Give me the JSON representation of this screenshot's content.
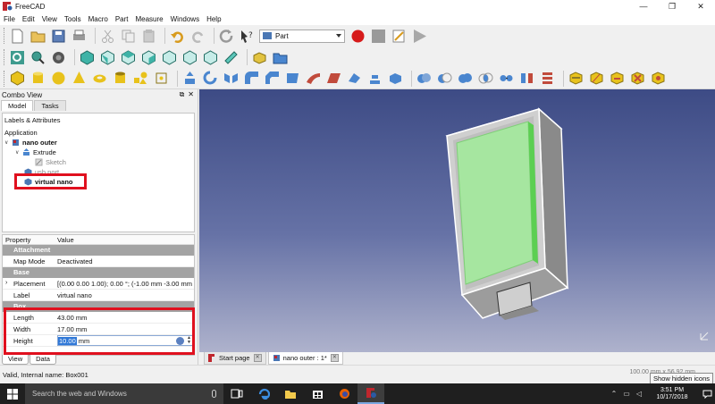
{
  "window": {
    "title": "FreeCAD",
    "minimize": "—",
    "maximize": "❐",
    "close": "✕"
  },
  "menu": [
    "File",
    "Edit",
    "View",
    "Tools",
    "Macro",
    "Part",
    "Measure",
    "Windows",
    "Help"
  ],
  "toolbar": {
    "workbench": "Part"
  },
  "combo_view": {
    "title": "Combo View",
    "tabs": [
      "Model",
      "Tasks"
    ],
    "tree_label": "Labels & Attributes",
    "application": "Application",
    "tree": {
      "document": "nano outer",
      "extrude": "Extrude",
      "sketch": "Sketch",
      "usb_port": "usb port",
      "virtual_nano": "virtual nano"
    }
  },
  "properties": {
    "header_property": "Property",
    "header_value": "Value",
    "groups": {
      "attachment": "Attachment",
      "base": "Base",
      "box": "Box"
    },
    "map_mode": {
      "name": "Map Mode",
      "value": "Deactivated"
    },
    "placement": {
      "name": "Placement",
      "value": "[(0.00 0.00 1.00); 0.00 °; (-1.00 mm  -3.00 mm  0.00 mm)]"
    },
    "label": {
      "name": "Label",
      "value": "virtual nano"
    },
    "length": {
      "name": "Length",
      "value": "43.00 mm"
    },
    "width": {
      "name": "Width",
      "value": "17.00 mm"
    },
    "height": {
      "name": "Height",
      "value_selected": "10.00",
      "unit": "mm"
    }
  },
  "bottom_tabs": [
    "View",
    "Data"
  ],
  "document_tabs": [
    {
      "label": "Start page"
    },
    {
      "label": "nano outer : 1*"
    }
  ],
  "status": {
    "message": "Valid, Internal name: Box001",
    "dimensions": "100.00 mm x 56.92 mm",
    "tooltip": "Show hidden icons"
  },
  "taskbar": {
    "search_placeholder": "Search the web and Windows",
    "time": "3:51 PM",
    "date": "10/17/2018"
  },
  "colors": {
    "highlight_red": "#e0101e",
    "model_green": "#a6e6a0",
    "viewport_top": "#3d4b85",
    "viewport_bottom": "#aeb2cc"
  }
}
